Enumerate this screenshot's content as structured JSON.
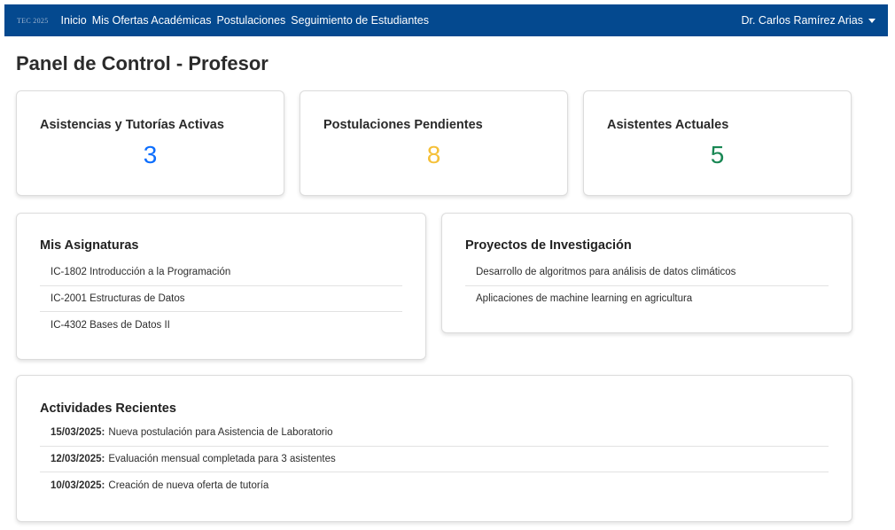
{
  "navbar": {
    "brand": "TEC 2025",
    "links": [
      "Inicio",
      "Mis Ofertas Académicas",
      "Postulaciones",
      "Seguimiento de Estudiantes"
    ],
    "user": "Dr. Carlos Ramírez Arias"
  },
  "page": {
    "title": "Panel de Control - Profesor"
  },
  "stats": [
    {
      "title": "Asistencias y Tutorías Activas",
      "value": "3",
      "color": "#0d6efd"
    },
    {
      "title": "Postulaciones Pendientes",
      "value": "8",
      "color": "#f5c038"
    },
    {
      "title": "Asistentes Actuales",
      "value": "5",
      "color": "#198754"
    }
  ],
  "subjects": {
    "title": "Mis Asignaturas",
    "items": [
      "IC-1802 Introducción a la Programación",
      "IC-2001 Estructuras de Datos",
      "IC-4302 Bases de Datos II"
    ]
  },
  "projects": {
    "title": "Proyectos de Investigación",
    "items": [
      "Desarrollo de algoritmos para análisis de datos climáticos",
      "Aplicaciones de machine learning en agricultura"
    ]
  },
  "activities": {
    "title": "Actividades Recientes",
    "items": [
      {
        "date": "15/03/2025:",
        "text": "Nueva postulación para Asistencia de Laboratorio"
      },
      {
        "date": "12/03/2025:",
        "text": "Evaluación mensual completada para 3 asistentes"
      },
      {
        "date": "10/03/2025:",
        "text": "Creación de nueva oferta de tutoría"
      }
    ]
  }
}
